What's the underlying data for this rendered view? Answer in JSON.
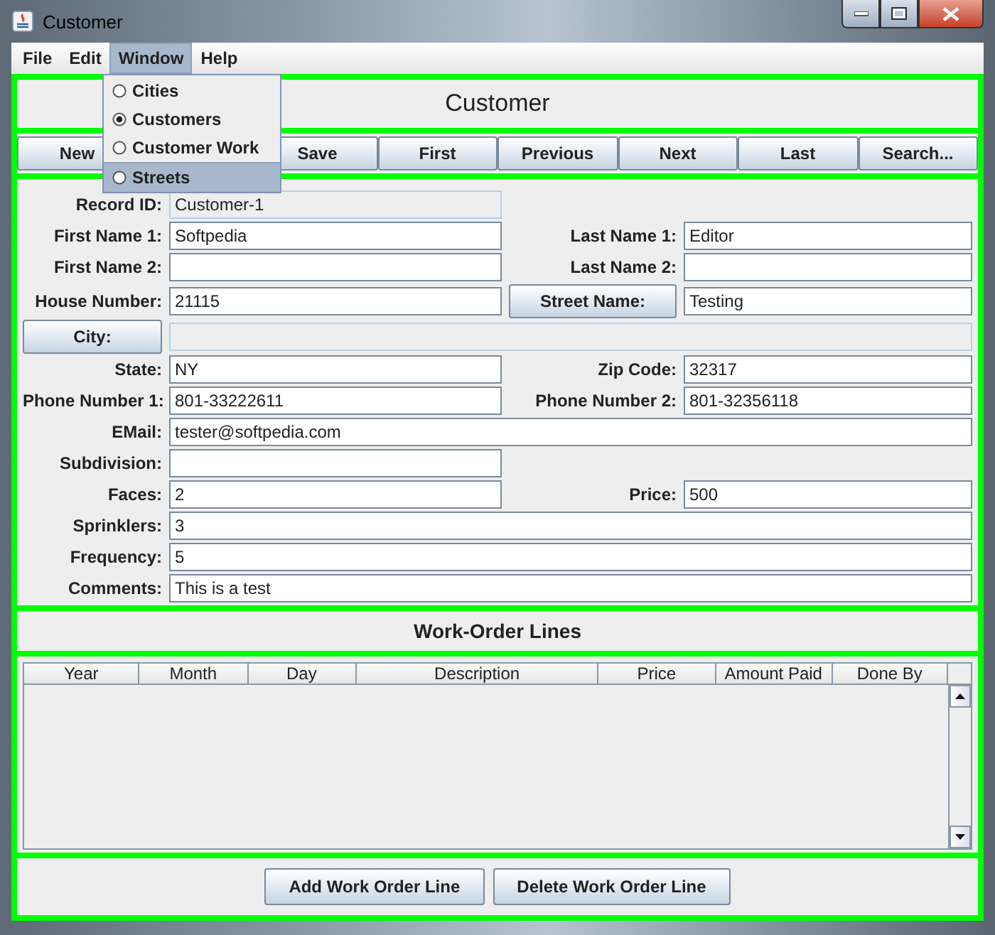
{
  "window": {
    "title": "Customer"
  },
  "menu_bar": [
    {
      "label": "File",
      "open": false
    },
    {
      "label": "Edit",
      "open": false
    },
    {
      "label": "Window",
      "open": true
    },
    {
      "label": "Help",
      "open": false
    }
  ],
  "open_menu": {
    "items": [
      {
        "label": "Cities",
        "selected": false,
        "highlighted": false
      },
      {
        "label": "Customers",
        "selected": true,
        "highlighted": false
      },
      {
        "label": "Customer Work",
        "selected": false,
        "highlighted": false
      },
      {
        "label": "Streets",
        "selected": false,
        "highlighted": true
      }
    ]
  },
  "header": {
    "title": "Customer"
  },
  "toolbar": {
    "buttons": [
      "New",
      "Save",
      "First",
      "Previous",
      "Next",
      "Last",
      "Search..."
    ]
  },
  "form": {
    "rows": [
      {
        "kind": "pair",
        "fields": [
          {
            "label": "Record ID:",
            "kind": "text",
            "value": "Customer-1",
            "disabled": true
          }
        ]
      },
      {
        "kind": "pair",
        "fields": [
          {
            "label": "First Name 1:",
            "kind": "text",
            "value": "Softpedia",
            "disabled": false
          },
          {
            "label": "Last Name 1:",
            "kind": "text",
            "value": "Editor",
            "disabled": false
          }
        ]
      },
      {
        "kind": "pair",
        "fields": [
          {
            "label": "First Name 2:",
            "kind": "text",
            "disabled": false
          },
          {
            "label": "Last Name 2:",
            "kind": "text",
            "disabled": false
          }
        ]
      },
      {
        "kind": "pair",
        "fields": [
          {
            "label": "House Number:",
            "kind": "text",
            "value": "21115",
            "disabled": false
          },
          {
            "label": "Street Name:",
            "kind": "button",
            "value": "Testing",
            "disabled": false
          }
        ]
      },
      {
        "kind": "wide",
        "fields": [
          {
            "label": "City:",
            "kind": "button",
            "disabled": true
          }
        ]
      },
      {
        "kind": "pair",
        "fields": [
          {
            "label": "State:",
            "kind": "text",
            "value": "NY",
            "disabled": false
          },
          {
            "label": "Zip Code:",
            "kind": "text",
            "value": "32317",
            "disabled": false
          }
        ]
      },
      {
        "kind": "pair",
        "fields": [
          {
            "label": "Phone Number 1:",
            "kind": "text",
            "value": "801-33222611",
            "disabled": false
          },
          {
            "label": "Phone Number 2:",
            "kind": "text",
            "value": "801-32356118",
            "disabled": false
          }
        ]
      },
      {
        "kind": "wide",
        "fields": [
          {
            "label": "EMail:",
            "kind": "text",
            "value": "tester@softpedia.com",
            "disabled": false
          }
        ]
      },
      {
        "kind": "pair",
        "fields": [
          {
            "label": "Subdivision:",
            "kind": "text",
            "disabled": false
          }
        ]
      },
      {
        "kind": "pair",
        "fields": [
          {
            "label": "Faces:",
            "kind": "text",
            "value": "2",
            "disabled": false
          },
          {
            "label": "Price:",
            "kind": "text",
            "value": "500",
            "disabled": false
          }
        ]
      },
      {
        "kind": "wide",
        "fields": [
          {
            "label": "Sprinklers:",
            "kind": "text",
            "value": "3",
            "disabled": false
          }
        ]
      },
      {
        "kind": "wide",
        "fields": [
          {
            "label": "Frequency:",
            "kind": "text",
            "value": "5",
            "disabled": false
          }
        ]
      },
      {
        "kind": "wide",
        "fields": [
          {
            "label": "Comments:",
            "kind": "text",
            "value": "This is a test",
            "disabled": false
          }
        ]
      }
    ]
  },
  "work_order_section": {
    "title": "Work-Order Lines"
  },
  "table": {
    "columns": [
      "Year",
      "Month",
      "Day",
      "Description",
      "Price",
      "Amount Paid",
      "Done By"
    ]
  },
  "buttons": [
    "Add Work Order Line",
    "Delete Work Order Line"
  ]
}
